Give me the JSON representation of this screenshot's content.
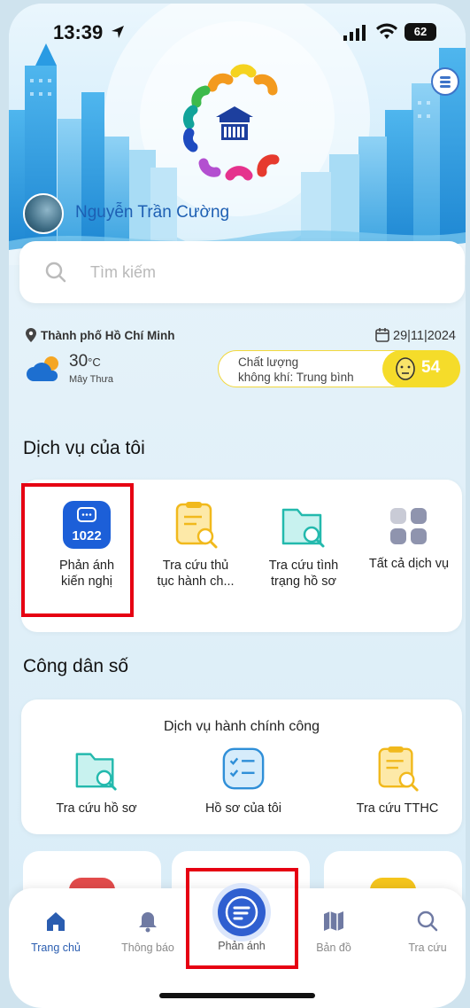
{
  "status_bar": {
    "time": "13:39",
    "battery": "62"
  },
  "header": {
    "user_name": "Nguyễn Trần Cường"
  },
  "search": {
    "placeholder": "Tìm kiếm"
  },
  "weather": {
    "location": "Thành phố Hồ Chí Minh",
    "date": "29|11|2024",
    "temperature": "30",
    "temperature_unit": "°C",
    "description": "Mây Thưa",
    "aqi_label_line1": "Chất lượng",
    "aqi_label_line2": "không khí: Trung bình",
    "aqi_value": "54"
  },
  "my_services": {
    "title": "Dịch vụ của tôi",
    "items": [
      {
        "line1": "Phản ánh",
        "line2": "kiến nghị",
        "badge": "1022",
        "icon": "feedback-1022-icon"
      },
      {
        "line1": "Tra cứu thủ",
        "line2": "tục hành ch...",
        "icon": "document-search-icon"
      },
      {
        "line1": "Tra cứu tình",
        "line2": "trạng hồ sơ",
        "icon": "folder-search-icon"
      },
      {
        "line1": "Tất cả dịch vụ",
        "line2": "",
        "icon": "grid-icon"
      }
    ]
  },
  "citizen": {
    "title": "Công dân số",
    "subtitle": "Dịch vụ hành chính công",
    "items": [
      {
        "label": "Tra cứu hồ sơ",
        "icon": "folder-search-icon"
      },
      {
        "label": "Hồ sơ của tôi",
        "icon": "checklist-icon"
      },
      {
        "label": "Tra cứu TTHC",
        "icon": "document-search-icon"
      }
    ]
  },
  "bottom_nav": {
    "items": [
      {
        "label": "Trang chủ",
        "icon": "home-icon",
        "active": true
      },
      {
        "label": "Thông báo",
        "icon": "bell-icon"
      },
      {
        "label": "Phản ánh",
        "icon": "feedback-icon"
      },
      {
        "label": "Bản đồ",
        "icon": "map-icon"
      },
      {
        "label": "Tra cứu",
        "icon": "search-icon"
      }
    ]
  },
  "colors": {
    "primary": "#2a5db0",
    "highlight": "#e60012",
    "aqi": "#f5dc2a"
  }
}
